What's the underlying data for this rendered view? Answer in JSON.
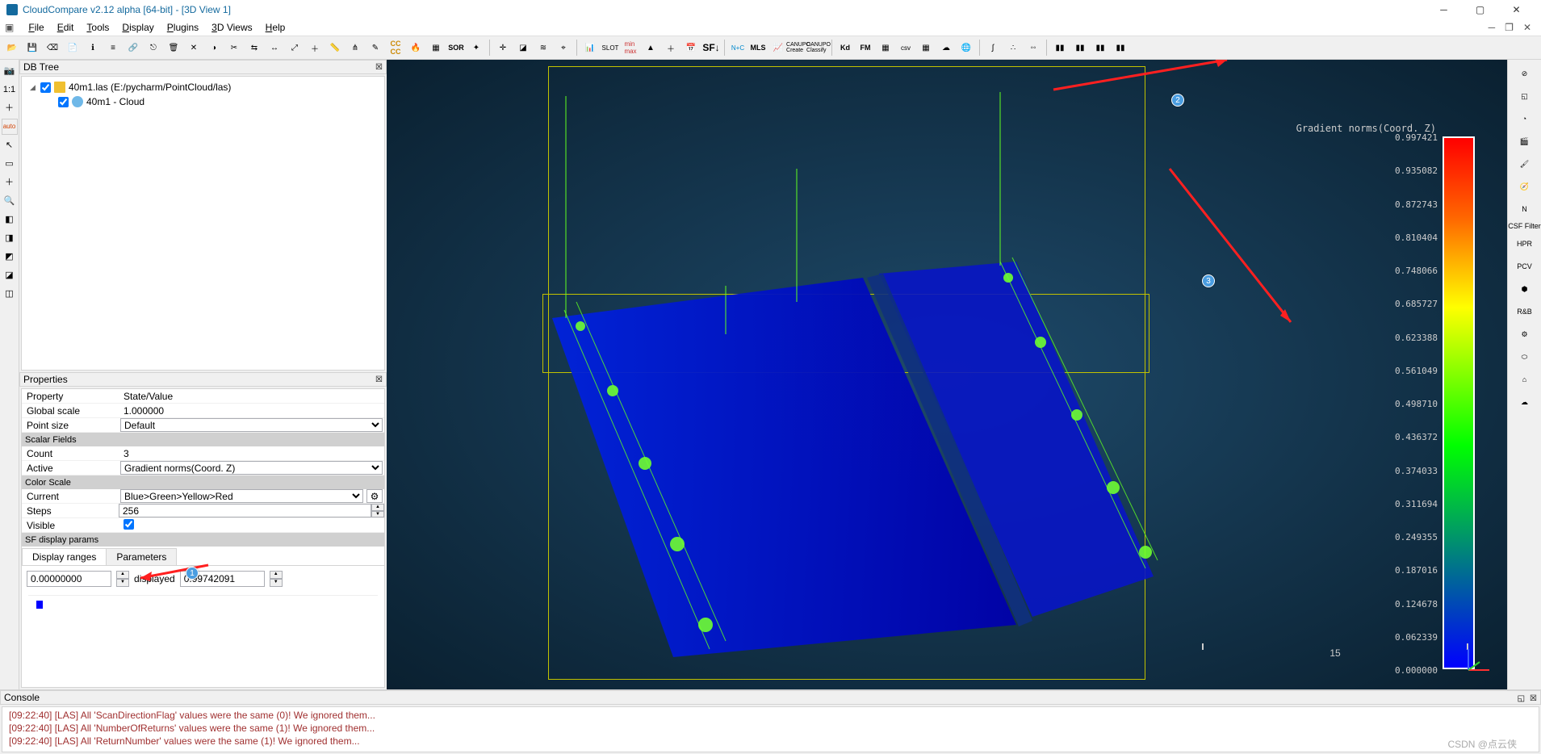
{
  "title": "CloudCompare v2.12 alpha [64-bit] - [3D View 1]",
  "menu": [
    "File",
    "Edit",
    "Tools",
    "Display",
    "Plugins",
    "3D Views",
    "Help"
  ],
  "sidebar_tools": [
    "📷",
    "1:1",
    "＋",
    "auto",
    "↖",
    "▭",
    "＋",
    "🔍",
    "◧",
    "◨",
    "◩",
    "◪",
    "◫"
  ],
  "db_tree": {
    "title": "DB Tree",
    "items": [
      {
        "label": "40m1.las (E:/pycharm/PointCloud/las)",
        "depth": 0,
        "icon": "folder",
        "expanded": true,
        "checked": true
      },
      {
        "label": "40m1 - Cloud",
        "depth": 1,
        "icon": "cloud",
        "expanded": false,
        "checked": true
      }
    ]
  },
  "properties": {
    "title": "Properties",
    "header": {
      "k": "Property",
      "v": "State/Value"
    },
    "global_scale": {
      "k": "Global scale",
      "v": "1.000000"
    },
    "point_size": {
      "k": "Point size",
      "v": "Default"
    },
    "sf_hdr": "Scalar Fields",
    "count": {
      "k": "Count",
      "v": "3"
    },
    "active": {
      "k": "Active",
      "v": "Gradient norms(Coord. Z)"
    },
    "cs_hdr": "Color Scale",
    "current": {
      "k": "Current",
      "v": "Blue>Green>Yellow>Red"
    },
    "steps": {
      "k": "Steps",
      "v": "256"
    },
    "visible": {
      "k": "Visible",
      "checked": true
    },
    "sfdisp_hdr": "SF display params",
    "tabs": [
      "Display ranges",
      "Parameters"
    ],
    "range_min": "0.00000000",
    "range_lbl": "displayed",
    "range_max": "0.99742091"
  },
  "colorbar": {
    "title": "Gradient norms(Coord. Z)",
    "ticks": [
      "0.997421",
      "0.935082",
      "0.872743",
      "0.810404",
      "0.748066",
      "0.685727",
      "0.623388",
      "0.561049",
      "0.498710",
      "0.436372",
      "0.374033",
      "0.311694",
      "0.249355",
      "0.187016",
      "0.124678",
      "0.062339",
      "0.000000"
    ]
  },
  "right_tools_label": "CSF Filter",
  "right_tools": [
    "⊘",
    "◱",
    "◔",
    "🎬",
    "🖌",
    "🧭",
    "N",
    "HPR",
    "PCV",
    "⬢",
    "R&B",
    "⚙",
    "⬭",
    "⌂",
    "☁"
  ],
  "scalebar": "15",
  "console": {
    "title": "Console",
    "lines": [
      "[09:22:40] [LAS] All 'ScanDirectionFlag' values were the same (0)! We ignored them...",
      "[09:22:40] [LAS] All 'NumberOfReturns' values were the same (1)! We ignored them...",
      "[09:22:40] [LAS] All 'ReturnNumber' values were the same (1)! We ignored them..."
    ]
  },
  "badges": [
    "1",
    "2",
    "3"
  ],
  "watermark": "CSDN @点云侠"
}
